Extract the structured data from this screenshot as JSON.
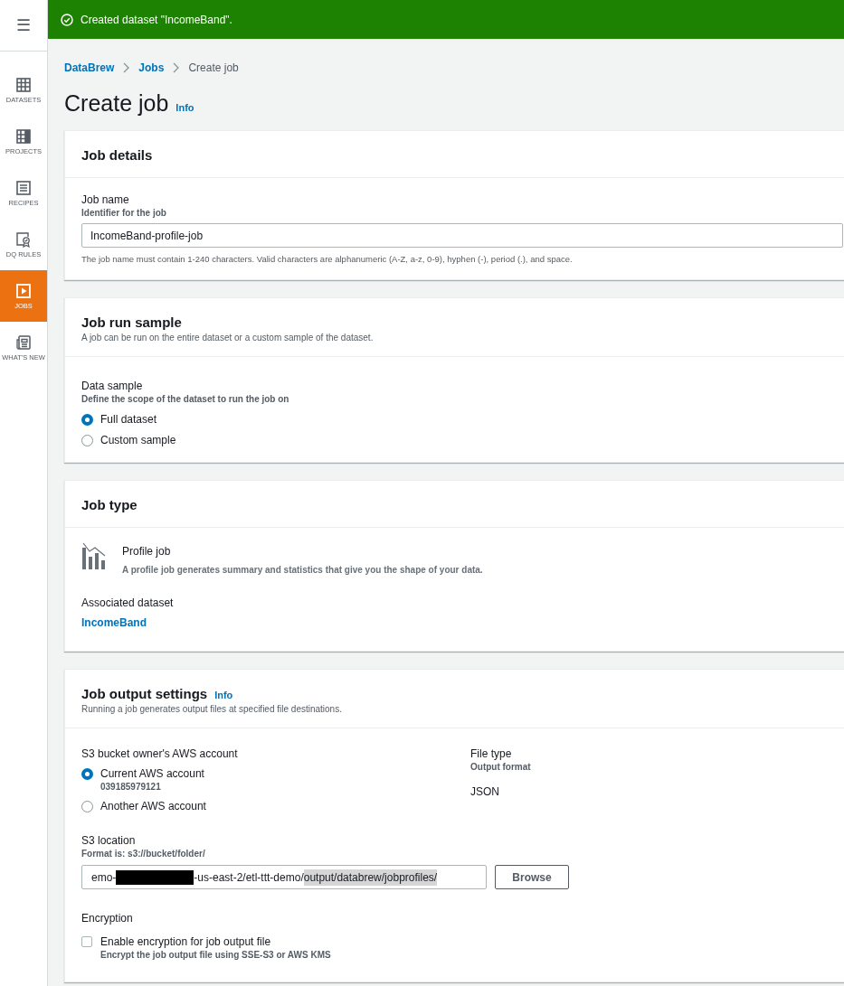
{
  "sidebar": {
    "menu_icon": "☰",
    "items": [
      {
        "label": "DATASETS",
        "kind": "datasets",
        "selected": false
      },
      {
        "label": "PROJECTS",
        "kind": "projects",
        "selected": false
      },
      {
        "label": "RECIPES",
        "kind": "recipes",
        "selected": false
      },
      {
        "label": "DQ RULES",
        "kind": "dqrules",
        "selected": false
      },
      {
        "label": "JOBS",
        "kind": "jobs",
        "selected": true
      },
      {
        "label": "WHAT'S NEW",
        "kind": "news",
        "selected": false
      }
    ]
  },
  "flash": {
    "message": "Created dataset \"IncomeBand\"."
  },
  "breadcrumbs": [
    {
      "label": "DataBrew",
      "link": true
    },
    {
      "label": "Jobs",
      "link": true
    },
    {
      "label": "Create job",
      "link": false
    }
  ],
  "page": {
    "title": "Create job",
    "info": "Info"
  },
  "job_details": {
    "title": "Job details",
    "job_name": {
      "label": "Job name",
      "description": "Identifier for the job",
      "value": "IncomeBand-profile-job",
      "constraint": "The job name must contain 1-240 characters. Valid characters are alphanumeric (A-Z, a-z, 0-9), hyphen (-), period (.), and space."
    }
  },
  "job_run_sample": {
    "title": "Job run sample",
    "description": "A job can be run on the entire dataset or a custom sample of the dataset.",
    "data_sample": {
      "label": "Data sample",
      "description": "Define the scope of the dataset to run the job on",
      "options": [
        {
          "label": "Full dataset",
          "selected": true
        },
        {
          "label": "Custom sample",
          "selected": false
        }
      ]
    }
  },
  "job_type": {
    "title": "Job type",
    "type_name": "Profile job",
    "type_description": "A profile job generates summary and statistics that give you the shape of your data.",
    "associated_label": "Associated dataset",
    "associated_dataset": "IncomeBand"
  },
  "job_output_settings": {
    "title": "Job output settings",
    "info": "Info",
    "description": "Running a job generates output files at specified file destinations.",
    "owner": {
      "label": "S3 bucket owner's AWS account",
      "options": [
        {
          "label": "Current AWS account",
          "detail": "039185979121",
          "selected": true
        },
        {
          "label": "Another AWS account",
          "selected": false
        }
      ]
    },
    "file_type": {
      "label": "File type",
      "description": "Output format",
      "value": "JSON"
    },
    "s3_location": {
      "label": "S3 location",
      "description": "Format is: s3://bucket/folder/",
      "value_start": "emo-",
      "redacted": true,
      "value_middle": "-us-east-2/etl-ttt-demo/",
      "value_selected": "output/databrew/jobprofiles/",
      "browse": "Browse"
    },
    "encryption": {
      "label": "Encryption",
      "checkbox_label": "Enable encryption for job output file",
      "checkbox_description": "Encrypt the job output file using SSE-S3 or AWS KMS",
      "checked": false
    }
  }
}
